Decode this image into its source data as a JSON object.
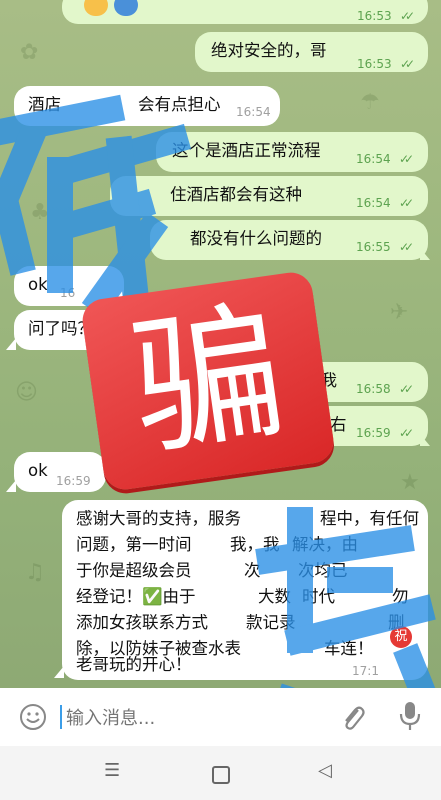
{
  "messages": [
    {
      "text": "绝对安全的，哥",
      "time": "16:53"
    },
    {
      "text": "酒店",
      "time": "16:54"
    },
    {
      "text": "会有点担心",
      "time": ""
    },
    {
      "text": "这个是酒店正常流程",
      "time": "16:54"
    },
    {
      "text": "住酒店都会有这种",
      "time": "16:54"
    },
    {
      "text": "都没有什么问题的",
      "time": "16:55"
    },
    {
      "text": "ok",
      "time": "16"
    },
    {
      "text": "问了吗？妹子",
      "time": ""
    },
    {
      "text": "回我",
      "time": "16:58"
    },
    {
      "text": "右",
      "time": "16:59"
    },
    {
      "text": "ok",
      "time": "16:59"
    },
    {
      "lines": [
        "感谢大哥的支持，服务",
        "程中，有任何",
        "问题，第一时间",
        "我，我",
        "解决，由",
        "于你是超级会员",
        "次",
        "次均已",
        "经登记！✅由于",
        "大数",
        "时代",
        "勿",
        "添加女孩联系方式",
        "款记录",
        "删",
        "除，以防妹子被查水表",
        "车连！",
        "老哥玩的开心！"
      ],
      "time": "17:1"
    }
  ],
  "top_time": "16:53",
  "input": {
    "placeholder": "输入消息..."
  },
  "stamp_char": "骗",
  "badge": "祝",
  "icons": {
    "emoji": "emoji-icon",
    "attach": "attach-icon",
    "mic": "mic-icon"
  }
}
